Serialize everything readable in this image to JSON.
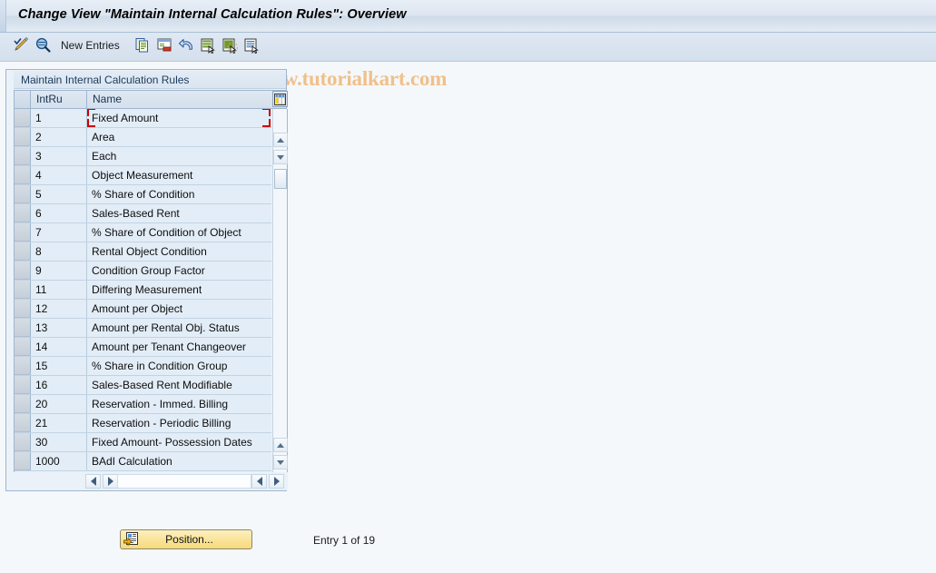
{
  "window": {
    "title": "Change View \"Maintain Internal Calculation Rules\": Overview"
  },
  "toolbar": {
    "items": [
      {
        "name": "display-change-icon",
        "icon": "pencil-check-icon",
        "label": ""
      },
      {
        "name": "check-entries-icon",
        "icon": "magnifier-icon",
        "label": ""
      }
    ],
    "new_entries_label": "New Entries",
    "action_icons": [
      {
        "name": "copy-as-icon",
        "icon": "copy-icon"
      },
      {
        "name": "delete-icon",
        "icon": "delete-row-icon"
      },
      {
        "name": "undo-change-icon",
        "icon": "undo-arrow-icon"
      },
      {
        "name": "select-all-icon",
        "icon": "select-all-icon"
      },
      {
        "name": "deselect-all-icon",
        "icon": "deselect-all-icon"
      },
      {
        "name": "variable-list-icon",
        "icon": "list-cursor-icon"
      }
    ]
  },
  "watermark": {
    "text": "www.tutorialkart.com"
  },
  "panel": {
    "title": "Maintain Internal Calculation Rules",
    "columns": [
      {
        "key": "intru",
        "label": "IntRu"
      },
      {
        "key": "name",
        "label": "Name"
      }
    ],
    "rows": [
      {
        "intru": "1",
        "name": "Fixed Amount"
      },
      {
        "intru": "2",
        "name": "Area"
      },
      {
        "intru": "3",
        "name": "Each"
      },
      {
        "intru": "4",
        "name": "Object Measurement"
      },
      {
        "intru": "5",
        "name": "% Share of Condition"
      },
      {
        "intru": "6",
        "name": "Sales-Based Rent"
      },
      {
        "intru": "7",
        "name": "% Share of Condition of Object"
      },
      {
        "intru": "8",
        "name": "Rental Object Condition"
      },
      {
        "intru": "9",
        "name": "Condition Group Factor"
      },
      {
        "intru": "11",
        "name": "Differing Measurement"
      },
      {
        "intru": "12",
        "name": "Amount per Object"
      },
      {
        "intru": "13",
        "name": "Amount per Rental Obj. Status"
      },
      {
        "intru": "14",
        "name": "Amount per Tenant Changeover"
      },
      {
        "intru": "15",
        "name": "% Share in Condition Group"
      },
      {
        "intru": "16",
        "name": "Sales-Based Rent Modifiable"
      },
      {
        "intru": "20",
        "name": "Reservation - Immed. Billing"
      },
      {
        "intru": "21",
        "name": "Reservation - Periodic Billing"
      },
      {
        "intru": "30",
        "name": "Fixed Amount- Possession Dates"
      },
      {
        "intru": "1000",
        "name": "BAdI Calculation"
      }
    ],
    "column_config_icon": "column-settings-icon"
  },
  "footer": {
    "position_button_label": "Position...",
    "position_button_icon": "position-goto-icon",
    "entry_status": "Entry 1 of 19"
  },
  "colors": {
    "accent_blue": "#9fb6cf",
    "row_background": "#e3edf7",
    "selection_red": "#cc0000",
    "watermark_orange": "#f0c08a",
    "button_yellow": "#fae49a"
  }
}
